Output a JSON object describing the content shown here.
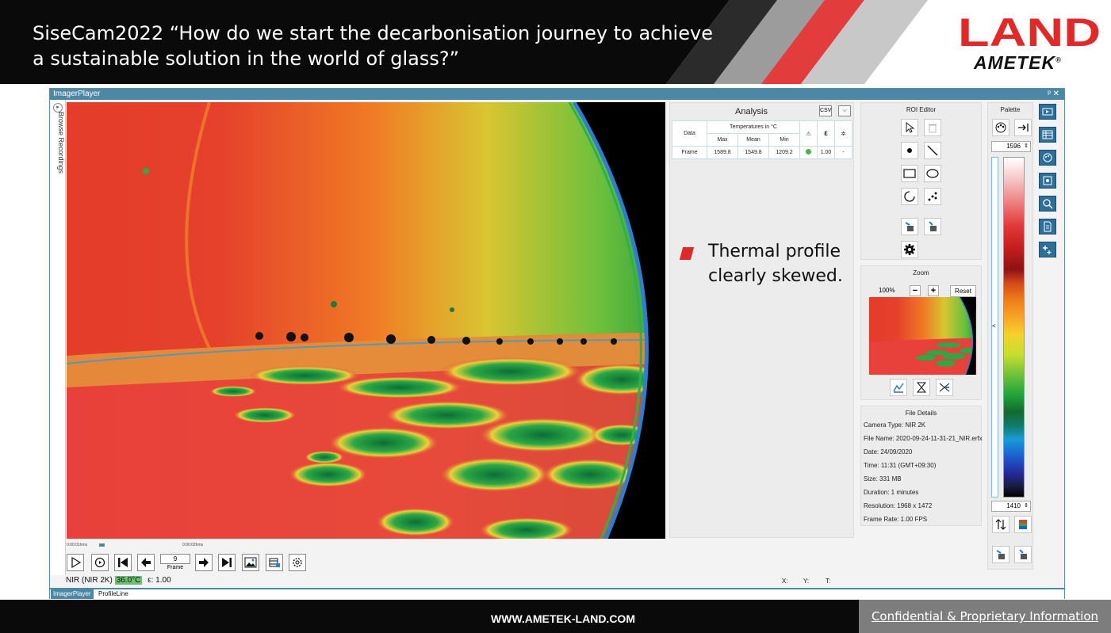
{
  "slide": {
    "title": "SiseCam2022 “How do we start the decarbonisation journey to achieve a sustainable solution in the world of glass?”",
    "logo_land": "LAND",
    "logo_ametek": "AMETEK",
    "logo_registered": "®",
    "footer_url": "WWW.AMETEK-LAND.COM",
    "footer_confidential": "Confidential & Proprietary Information"
  },
  "window": {
    "title": "ImagerPlayer",
    "controls": "ᵖ ✕",
    "sidebar_label": "Browse Recordings"
  },
  "analysis": {
    "title": "Analysis",
    "headers": {
      "data": "Data",
      "temps": "Temperatures in °C",
      "max": "Max",
      "mean": "Mean",
      "min": "Min",
      "emissivity": "ε"
    },
    "rows": [
      {
        "data": "Frame",
        "max": "1589.8",
        "mean": "1549.8",
        "min": "1209.2",
        "emissivity": "1.00",
        "extra": "-"
      }
    ],
    "note_line1": "Thermal profile",
    "note_line2": "clearly skewed."
  },
  "roi_editor": {
    "title": "ROI Editor"
  },
  "zoom": {
    "title": "Zoom",
    "level": "100%",
    "minus": "−",
    "plus": "+",
    "reset": "Reset"
  },
  "file_details": {
    "title": "File Details",
    "lines": [
      "Camera Type: NIR 2K",
      "File Name: 2020-09-24-11-31-21_NIR.erfx",
      "Date: 24/09/2020",
      "Time: 11:31 (GMT+09:30)",
      "Size: 331 MB",
      "Duration: 1 minutes",
      "Resolution: 1968 x 1472",
      "Frame Rate: 1.00 FPS"
    ]
  },
  "palette": {
    "title": "Palette",
    "max_value": "1596",
    "min_value": "1410",
    "collapse": "<"
  },
  "player": {
    "time_start": "0:00:01hms",
    "time_end": "0:00:02hms",
    "frame_value": "9",
    "frame_label": "Frame"
  },
  "status": {
    "camera": "NIR (NIR 2K)",
    "temp": "36.0°C",
    "emissivity": "ε: 1.00",
    "x": "X:",
    "y": "Y:",
    "t": "T:"
  },
  "tabs": [
    "ImagerPlayer",
    "ProfileLine"
  ],
  "colors": {
    "accent": "#4c87a6",
    "brand_red": "#e02a2a",
    "status_green": "#6fbf73"
  }
}
